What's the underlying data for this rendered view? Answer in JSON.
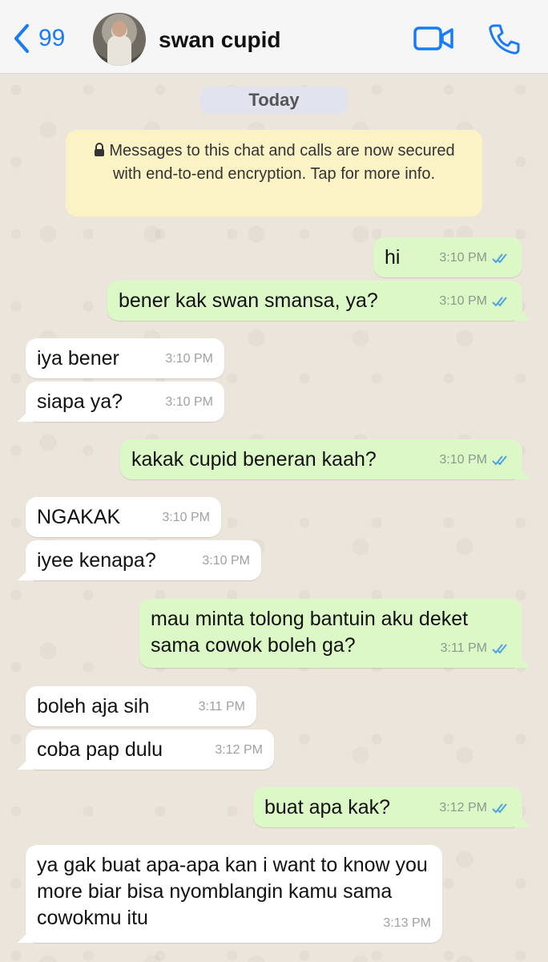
{
  "header": {
    "back_count": "99",
    "contact_name": "swan cupid"
  },
  "chat": {
    "date_label": "Today",
    "encryption_notice": "Messages to this chat and calls are now secured with end-to-end encryption. Tap for more info.",
    "messages": [
      {
        "dir": "out",
        "text": "hi",
        "time": "3:10 PM"
      },
      {
        "dir": "out",
        "text": "bener kak swan smansa, ya?",
        "time": "3:10 PM"
      },
      {
        "dir": "in",
        "text": "iya bener",
        "time": "3:10 PM"
      },
      {
        "dir": "in",
        "text": "siapa ya?",
        "time": "3:10 PM"
      },
      {
        "dir": "out",
        "text": "kakak cupid beneran kaah?",
        "time": "3:10 PM"
      },
      {
        "dir": "in",
        "text": "NGAKAK",
        "time": "3:10 PM"
      },
      {
        "dir": "in",
        "text": "iyee kenapa?",
        "time": "3:10 PM"
      },
      {
        "dir": "out",
        "text": "mau minta tolong bantuin aku deket sama cowok boleh ga?",
        "time": "3:11 PM"
      },
      {
        "dir": "in",
        "text": "boleh aja sih",
        "time": "3:11 PM"
      },
      {
        "dir": "in",
        "text": "coba pap dulu",
        "time": "3:12 PM"
      },
      {
        "dir": "out",
        "text": "buat apa kak?",
        "time": "3:12 PM"
      },
      {
        "dir": "in",
        "text": "ya gak buat apa-apa kan i want to know you more biar bisa nyomblangin kamu sama cowokmu itu",
        "time": "3:13 PM"
      }
    ]
  },
  "colors": {
    "accent": "#1a7cf5",
    "outgoing_bubble": "#dcf8c6",
    "incoming_bubble": "#ffffff",
    "read_ticks": "#4fa3e0"
  },
  "icons": [
    "chevron-left-icon",
    "video-call-icon",
    "phone-icon",
    "lock-icon",
    "double-check-icon"
  ]
}
